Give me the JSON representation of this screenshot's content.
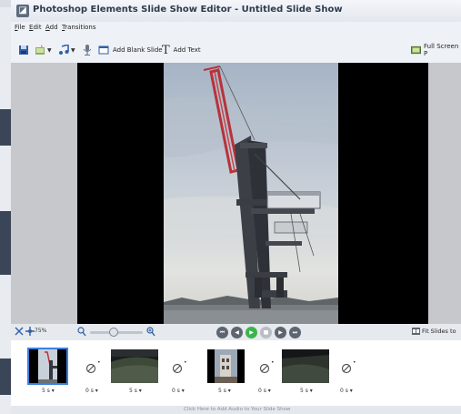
{
  "window": {
    "title": "Photoshop Elements Slide Show Editor - Untitled Slide Show"
  },
  "menu": {
    "items": [
      {
        "first": "F",
        "rest": "ile"
      },
      {
        "first": "E",
        "rest": "dit"
      },
      {
        "first": "A",
        "rest": "dd"
      },
      {
        "first": "T",
        "rest": "ransitions"
      }
    ]
  },
  "toolbar": {
    "add_blank_slide": "Add Blank Slide",
    "add_text": "Add Text",
    "full_screen": "Full Screen P"
  },
  "controls": {
    "zoom_level": "75%",
    "zoom_slider_fraction": 0.45,
    "fit_slides": "Fit Slides to"
  },
  "filmstrip": {
    "slides": [
      {
        "duration": "5 s",
        "selected": true
      },
      {
        "duration": "5 s",
        "selected": false
      },
      {
        "duration": "5 s",
        "selected": false
      },
      {
        "duration": "5 s",
        "selected": false
      }
    ],
    "transitions": [
      {
        "duration": "0 s"
      },
      {
        "duration": "0 s"
      },
      {
        "duration": "0 s"
      },
      {
        "duration": "0 s"
      }
    ]
  },
  "audio": {
    "hint": "Click Here to Add Audio to Your Slide Show"
  },
  "colors": {
    "selection": "#3c7fe0",
    "play_green": "#3bb54a"
  }
}
